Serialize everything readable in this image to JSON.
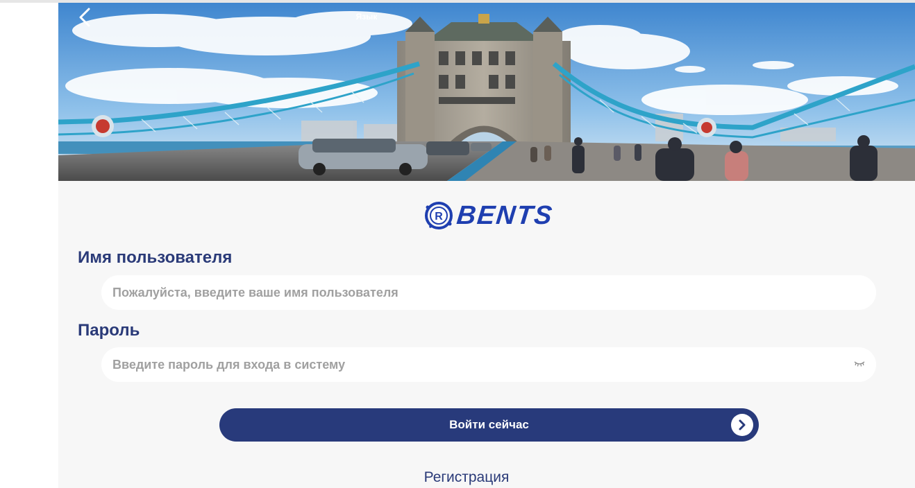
{
  "header": {
    "back_icon": "chevron-left-icon",
    "language_label": "Язык"
  },
  "hero": {
    "description_icon": "tower-bridge-photo"
  },
  "logo": {
    "brand_text": "BENTS",
    "mark_letter": "R",
    "brand_color": "#1f3fb0"
  },
  "form": {
    "username": {
      "label": "Имя пользователя",
      "value": "",
      "placeholder": "Пожалуйста, введите ваше имя пользователя"
    },
    "password": {
      "label": "Пароль",
      "value": "",
      "placeholder": "Введите пароль для входа в систему",
      "visibility_icon": "eye-closed-icon"
    },
    "login_button": {
      "label": "Войти сейчас",
      "icon": "arrow-right-circle-icon",
      "color": "#283a7b"
    },
    "register_label": "Регистрация"
  },
  "colors": {
    "page_bg": "#f7f7f7",
    "label_text": "#2a3a78",
    "placeholder_text": "#a0a0a0"
  }
}
